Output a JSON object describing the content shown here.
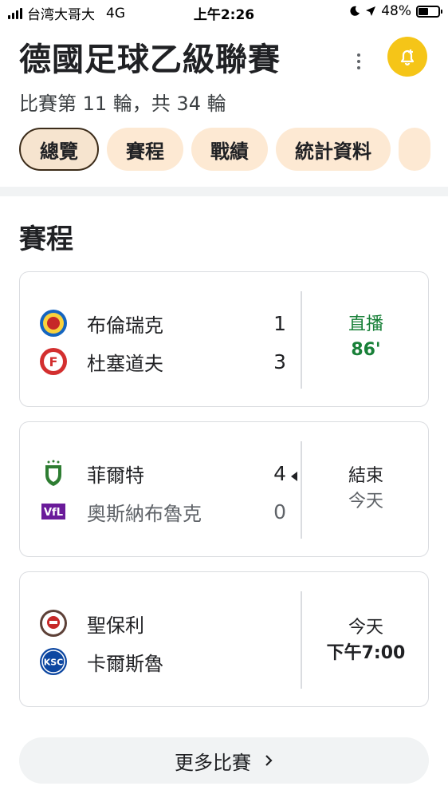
{
  "status_bar": {
    "carrier": "台湾大哥大",
    "network": "4G",
    "time": "上午2:26",
    "battery": "48%"
  },
  "header": {
    "title": "德國足球乙級聯賽",
    "subtitle": "比賽第 11 輪，共 34 輪",
    "accent_color": "#f5c518"
  },
  "tabs": [
    {
      "label": "總覽",
      "active": true
    },
    {
      "label": "賽程"
    },
    {
      "label": "戰績"
    },
    {
      "label": "統計資料"
    }
  ],
  "section": {
    "title": "賽程"
  },
  "matches": [
    {
      "home": {
        "name": "布倫瑞克",
        "score": "1",
        "logo": "braunschweig-crest-icon"
      },
      "away": {
        "name": "杜塞道夫",
        "score": "3",
        "logo": "dusseldorf-crest-icon"
      },
      "status_line1": "直播",
      "status_line2": "86'",
      "live": true
    },
    {
      "home": {
        "name": "菲爾特",
        "score": "4",
        "logo": "furth-crest-icon",
        "winner": true
      },
      "away": {
        "name": "奧斯納布魯克",
        "score": "0",
        "logo": "osnabruck-crest-icon"
      },
      "status_line1": "結束",
      "status_line2": "今天"
    },
    {
      "home": {
        "name": "聖保利",
        "score": "",
        "logo": "st-pauli-crest-icon"
      },
      "away": {
        "name": "卡爾斯魯",
        "score": "",
        "logo": "karlsruhe-crest-icon"
      },
      "status_line1": "今天",
      "status_line2": "下午7:00"
    }
  ],
  "more_matches": {
    "label": "更多比賽"
  }
}
